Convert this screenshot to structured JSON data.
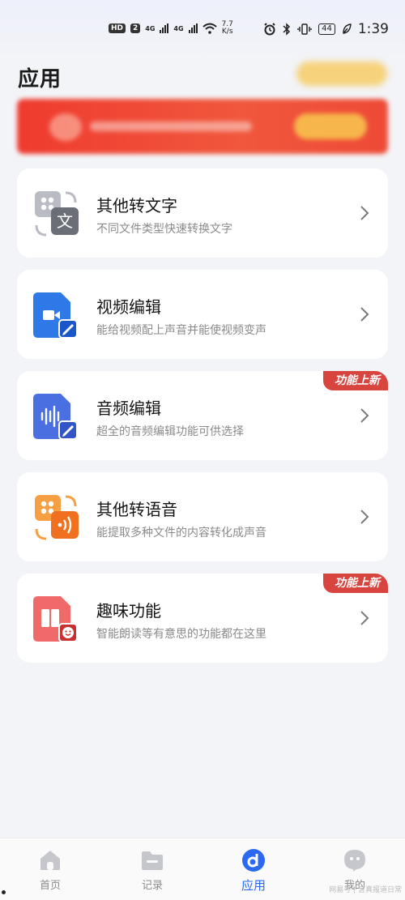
{
  "status_bar": {
    "hd": "HD",
    "sim": "2",
    "net1": "4G",
    "net2": "4G",
    "speed_value": "7.7",
    "speed_unit": "K/s",
    "battery": "44",
    "time": "1:39"
  },
  "header": {
    "title": "应用"
  },
  "cards": [
    {
      "title": "其他转文字",
      "subtitle": "不同文件类型快速转换文字",
      "badge": "",
      "icon": "image-to-text-icon"
    },
    {
      "title": "视频编辑",
      "subtitle": "能给视频配上声音并能使视频变声",
      "badge": "",
      "icon": "video-edit-icon"
    },
    {
      "title": "音频编辑",
      "subtitle": "超全的音频编辑功能可供选择",
      "badge": "功能上新",
      "icon": "audio-edit-icon"
    },
    {
      "title": "其他转语音",
      "subtitle": "能提取多种文件的内容转化成声音",
      "badge": "",
      "icon": "text-to-speech-icon"
    },
    {
      "title": "趣味功能",
      "subtitle": "智能朗读等有意思的功能都在这里",
      "badge": "功能上新",
      "icon": "fun-features-icon"
    }
  ],
  "card_icon_glyph": "文",
  "tabbar": {
    "items": [
      {
        "label": "首页",
        "icon": "home-icon"
      },
      {
        "label": "记录",
        "icon": "folder-icon"
      },
      {
        "label": "应用",
        "icon": "apps-icon",
        "active": true
      },
      {
        "label": "我的",
        "icon": "profile-icon"
      }
    ],
    "accent": "#2b6af0"
  },
  "watermark": "网易号 | 言真报道日常",
  "colors": {
    "badge": "#d7453e",
    "banner": "#ef3b2f",
    "background": "#f3f4f7"
  }
}
